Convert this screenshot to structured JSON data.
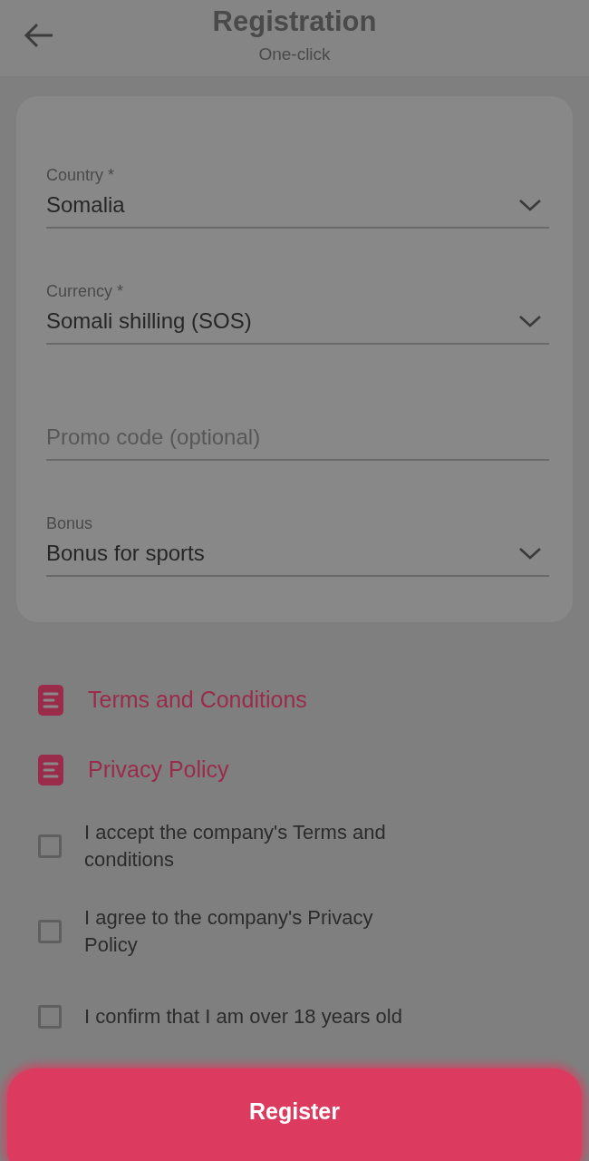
{
  "header": {
    "title": "Registration",
    "subtitle": "One-click"
  },
  "fields": [
    {
      "kind": "select",
      "label": "Country *",
      "value": "Somalia"
    },
    {
      "kind": "select",
      "label": "Currency *",
      "value": "Somali shilling (SOS)"
    },
    {
      "kind": "input",
      "placeholder": "Promo code (optional)"
    },
    {
      "kind": "select",
      "label": "Bonus",
      "value": "Bonus for sports"
    }
  ],
  "documents": [
    {
      "label": "Terms and Conditions"
    },
    {
      "label": "Privacy Policy"
    }
  ],
  "agreements": [
    {
      "label": "I accept the company's Terms and conditions",
      "checked": false
    },
    {
      "label": "I agree to the company's Privacy Policy",
      "checked": false
    },
    {
      "label": "I confirm that I am over 18 years old",
      "checked": false
    }
  ],
  "register_button": "Register"
}
